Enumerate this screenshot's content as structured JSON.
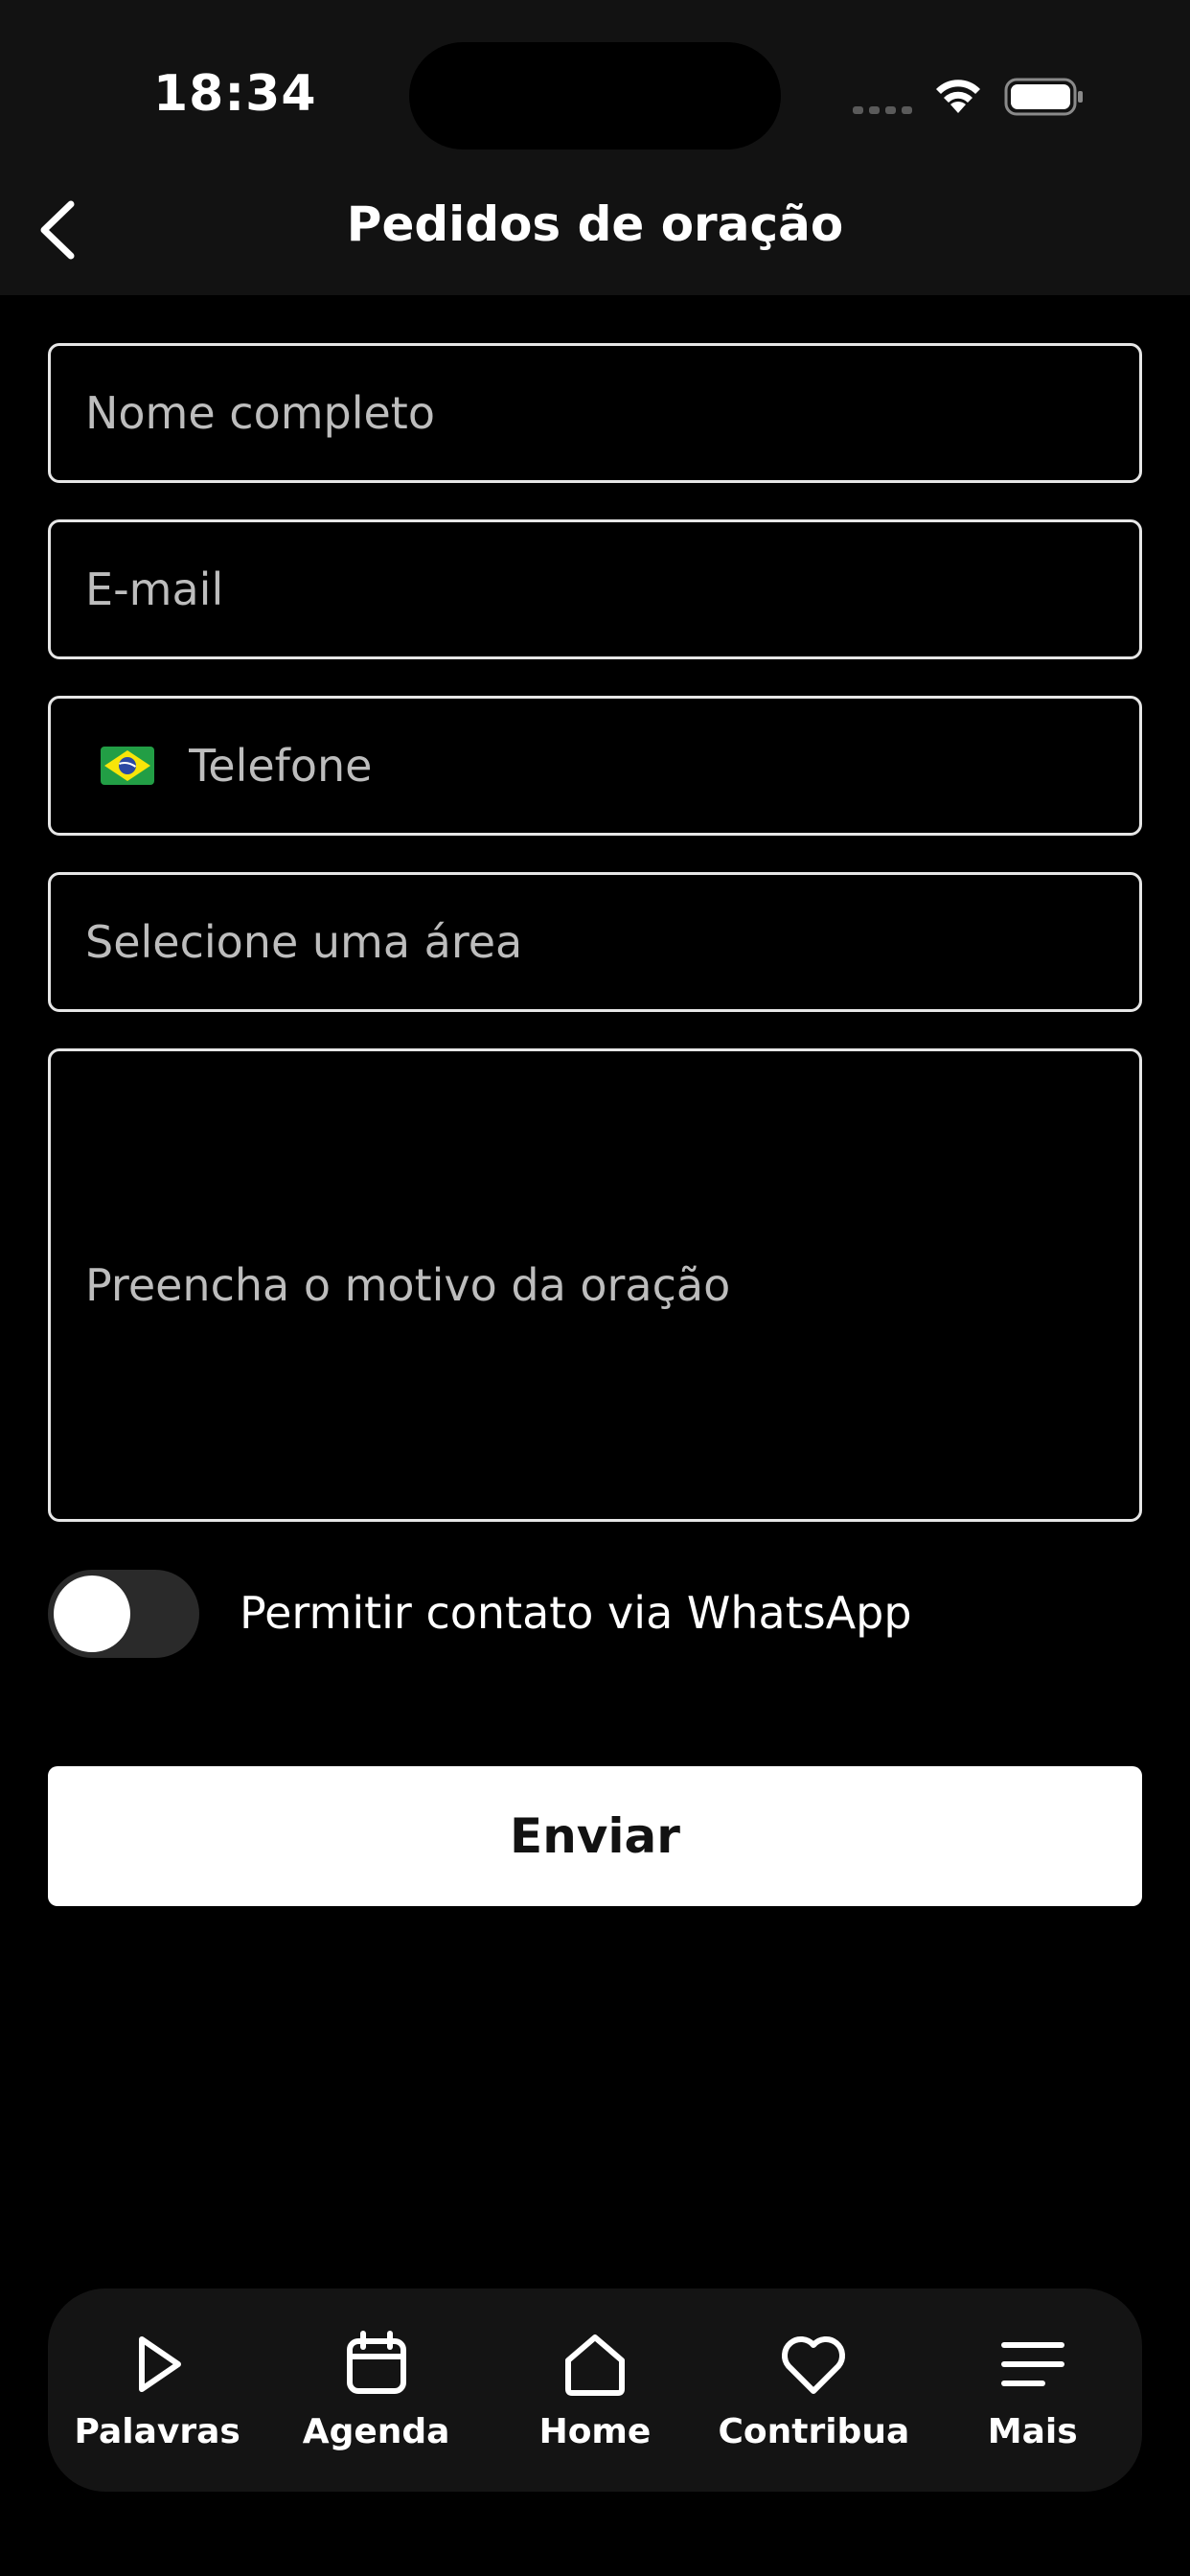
{
  "status_bar": {
    "time": "18:34"
  },
  "header": {
    "title": "Pedidos de oração"
  },
  "form": {
    "name_placeholder": "Nome completo",
    "email_placeholder": "E-mail",
    "phone_placeholder": "Telefone",
    "phone_country_icon": "brazil-flag-icon",
    "area_placeholder": "Selecione uma área",
    "reason_placeholder": "Preencha o motivo da oração",
    "whatsapp_toggle_label": "Permitir contato via WhatsApp",
    "whatsapp_toggle_on": false,
    "submit_label": "Enviar"
  },
  "tabbar": {
    "items": [
      {
        "label": "Palavras",
        "icon": "play-icon"
      },
      {
        "label": "Agenda",
        "icon": "calendar-icon"
      },
      {
        "label": "Home",
        "icon": "home-icon"
      },
      {
        "label": "Contribua",
        "icon": "heart-icon"
      },
      {
        "label": "Mais",
        "icon": "menu-icon"
      }
    ]
  },
  "colors": {
    "background": "#000000",
    "header_background": "#121212",
    "field_border": "#e6e6e6",
    "placeholder": "#bdbdbd",
    "button_background": "#ffffff",
    "tabbar_background": "#141414"
  }
}
